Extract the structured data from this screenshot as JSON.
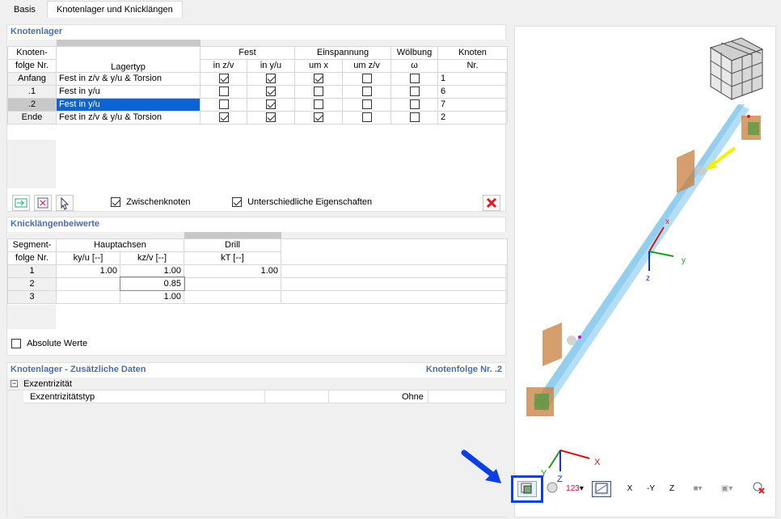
{
  "tabs": [
    "Basis",
    "Knotenlager und Knicklängen"
  ],
  "knotenlager": {
    "title": "Knotenlager",
    "group_headers": {
      "fest": "Fest",
      "einspannung": "Einspannung",
      "woelbung": "Wölbung",
      "knoten": "Knoten"
    },
    "col_headers": {
      "knotenfolge": "Knoten-",
      "knotenfolge2": "folge Nr.",
      "lagertyp": "Lagertyp",
      "fest_z": "in z/v",
      "fest_y": "in y/u",
      "einsp_x": "um x",
      "einsp_z": "um z/v",
      "woelb": "ω",
      "knoten_nr": "Nr."
    },
    "rows": [
      {
        "label": "Anfang",
        "lagertyp": "Fest in z/v & y/u & Torsion",
        "fz": true,
        "fy": true,
        "ex": true,
        "ez": false,
        "w": false,
        "knoten": "1"
      },
      {
        "label": ".1",
        "lagertyp": "Fest in y/u",
        "fz": false,
        "fy": true,
        "ex": false,
        "ez": false,
        "w": false,
        "knoten": "6"
      },
      {
        "label": ".2",
        "lagertyp": "Fest in y/u",
        "fz": false,
        "fy": true,
        "ex": false,
        "ez": false,
        "w": false,
        "knoten": "7"
      },
      {
        "label": "Ende",
        "lagertyp": "Fest in z/v & y/u & Torsion",
        "fz": true,
        "fy": true,
        "ex": true,
        "ez": false,
        "w": false,
        "knoten": "2"
      }
    ],
    "zwischenknoten": "Zwischenknoten",
    "unterschiedliche": "Unterschiedliche Eigenschaften"
  },
  "knick": {
    "title": "Knicklängenbeiwerte",
    "segment": "Segment-",
    "segment2": "folge Nr.",
    "hauptachsen": "Hauptachsen",
    "drill": "Drill",
    "ky": "ky/u [--]",
    "kz": "kz/v [--]",
    "kt": "kT [--]",
    "rows": [
      {
        "nr": "1",
        "ky": "1.00",
        "kz": "1.00",
        "kt": "1.00"
      },
      {
        "nr": "2",
        "ky": "",
        "kz": "0.85",
        "kt": ""
      },
      {
        "nr": "3",
        "ky": "",
        "kz": "1.00",
        "kt": ""
      }
    ],
    "absolute": "Absolute Werte"
  },
  "zusatz": {
    "title": "Knotenlager - Zusätzliche Daten",
    "right": "Knotenfolge Nr. .2",
    "group": "Exzentrizität",
    "item": "Exzentrizitätstyp",
    "value": "Ohne"
  },
  "axes": {
    "x": "x",
    "y": "y",
    "z": "z",
    "X": "X",
    "Y": "Y",
    "Z": "Z"
  },
  "toolbar": {
    "tx": "X",
    "ty": "-Y",
    "tz": "Z",
    "num": "123"
  }
}
